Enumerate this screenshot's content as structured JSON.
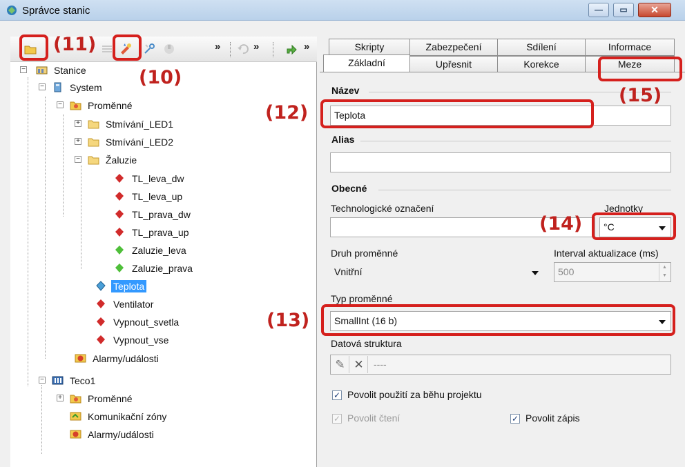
{
  "window": {
    "title": "Správce stanic"
  },
  "toolbar": {
    "chevrons": [
      "»",
      "»",
      "»",
      "»"
    ]
  },
  "annotations": {
    "a10": "(10)",
    "a11": "(11)",
    "a12": "(12)",
    "a13": "(13)",
    "a14": "(14)",
    "a15": "(15)"
  },
  "tree": {
    "root": "Stanice",
    "system": "System",
    "vars": "Proměnné",
    "led1": "Stmívání_LED1",
    "led2": "Stmívání_LED2",
    "zaluzie": "Žaluzie",
    "items": [
      "TL_leva_dw",
      "TL_leva_up",
      "TL_prava_dw",
      "TL_prava_up",
      "Zaluzie_leva",
      "Zaluzie_prava"
    ],
    "teplota": "Teplota",
    "ventilator": "Ventilator",
    "vypnout_svetla": "Vypnout_svetla",
    "vypnout_vse": "Vypnout_vse",
    "alarmy1": "Alarmy/události",
    "teco": "Teco1",
    "teco_vars": "Proměnné",
    "kom_zony": "Komunikační zóny",
    "alarmy2": "Alarmy/události"
  },
  "tabs": {
    "row1": [
      "Skripty",
      "Zabezpečení",
      "Sdílení",
      "Informace"
    ],
    "row2": [
      "Základní",
      "Upřesnit",
      "Korekce",
      "Meze"
    ]
  },
  "form": {
    "nazev_label": "Název",
    "nazev_value": "Teplota",
    "alias_label": "Alias",
    "alias_value": "",
    "obecne_label": "Obecné",
    "tech_label": "Technologické označení",
    "tech_value": "",
    "jednotky_label": "Jednotky",
    "jednotky_value": "°C",
    "druh_label": "Druh proměnné",
    "druh_value": "Vnitřní",
    "interval_label": "Interval aktualizace (ms)",
    "interval_value": "500",
    "typ_label": "Typ proměnné",
    "typ_value": "SmallInt (16 b)",
    "datova_label": "Datová struktura",
    "datova_value": "----",
    "chk_povolit_beh": "Povolit použití za běhu projektu",
    "chk_povolit_cteni": "Povolit čtení",
    "chk_povolit_zapis": "Povolit zápis"
  }
}
